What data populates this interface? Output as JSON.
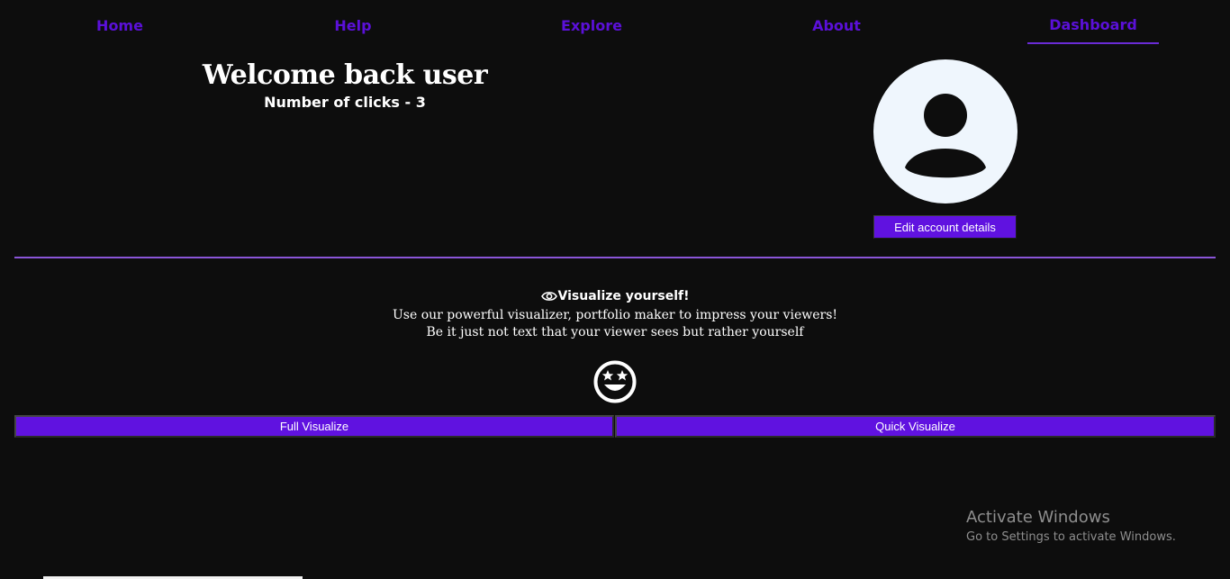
{
  "nav": {
    "home": "Home",
    "help": "Help",
    "explore": "Explore",
    "about": "About",
    "dashboard": "Dashboard"
  },
  "welcome": {
    "title": "Welcome back user",
    "clicks": "Number of clicks - 3"
  },
  "account": {
    "edit_label": "Edit account details"
  },
  "visualize": {
    "heading": "Visualize yourself!",
    "line1": "Use our powerful visualizer, portfolio maker to impress your viewers!",
    "line2": "Be it just not text that your viewer sees but rather yourself",
    "full_label": "Full Visualize",
    "quick_label": "Quick Visualize"
  },
  "watermark": {
    "title": "Activate Windows",
    "subtitle": "Go to Settings to activate Windows."
  },
  "colors": {
    "background": "#0d0d0d",
    "accent": "#6012e0",
    "nav_link": "#5b10d9",
    "divider": "#8a55d8",
    "avatar_bg": "#eff6fd"
  },
  "icons": {
    "avatar": "user-avatar-icon",
    "eye": "eye-icon",
    "smiley": "star-struck-smiley-icon"
  }
}
